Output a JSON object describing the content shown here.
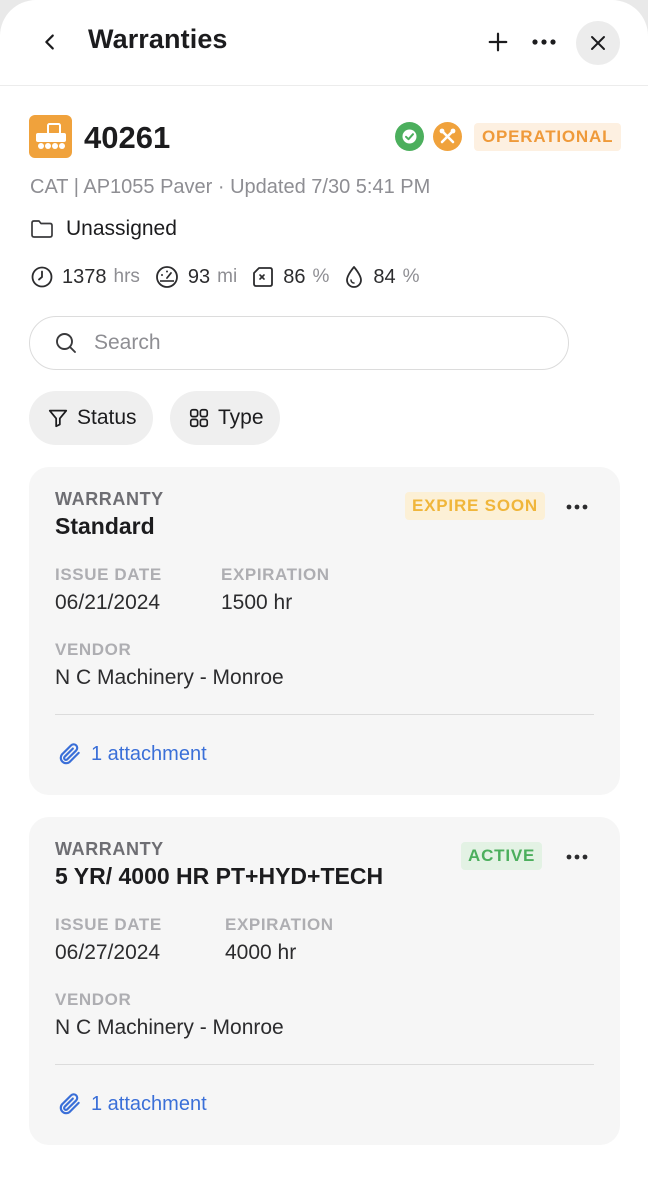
{
  "header": {
    "title": "Warranties"
  },
  "asset": {
    "id": "40261",
    "status": "OPERATIONAL",
    "subtitle": "CAT | AP1055 Paver · Updated 7/30 5:41 PM",
    "group": "Unassigned",
    "metrics": [
      {
        "value": "1378",
        "unit": "hrs",
        "icon": "clock-icon"
      },
      {
        "value": "93",
        "unit": "mi",
        "icon": "speedometer-icon"
      },
      {
        "value": "86",
        "unit": "%",
        "icon": "fuel-icon"
      },
      {
        "value": "84",
        "unit": "%",
        "icon": "drop-icon"
      }
    ]
  },
  "search": {
    "placeholder": "Search"
  },
  "filters": {
    "status_label": "Status",
    "type_label": "Type"
  },
  "labels": {
    "issue_date": "ISSUE DATE",
    "expiration": "EXPIRATION",
    "vendor": "VENDOR"
  },
  "warranties": [
    {
      "kind": "WARRANTY",
      "name": "Standard",
      "status": "EXPIRE SOON",
      "status_color": "#f0b63b",
      "issue_date": "06/21/2024",
      "expiration": "1500 hr",
      "vendor": "N C Machinery - Monroe",
      "attachments": "1 attachment"
    },
    {
      "kind": "WARRANTY",
      "name": "5 YR/ 4000 HR PT+HYD+TECH",
      "status": "ACTIVE",
      "status_color": "#4caf5d",
      "issue_date": "06/27/2024",
      "expiration": "4000 hr",
      "vendor": "N C Machinery - Monroe",
      "attachments": "1 attachment"
    }
  ],
  "colors": {
    "accent_orange": "#f0a23c",
    "status_green": "#4caf5d",
    "link_blue": "#3a6fd8"
  }
}
